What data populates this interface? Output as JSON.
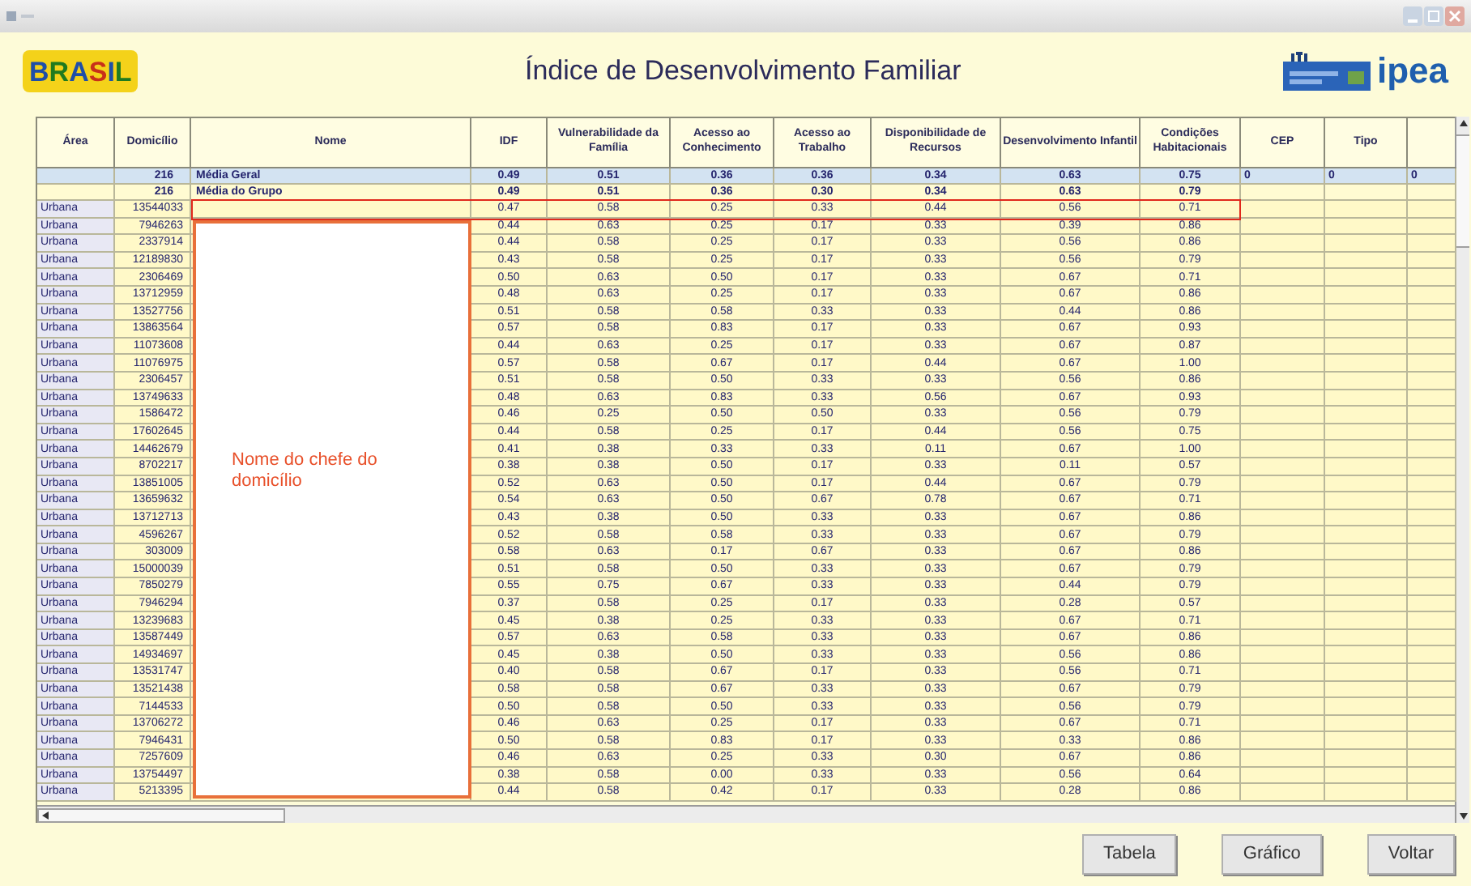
{
  "header": {
    "logo_left": "BRASIL",
    "title": "Índice de Desenvolvimento Familiar",
    "logo_right": "ipea"
  },
  "table": {
    "columns": [
      "Área",
      "Domicílio",
      "Nome",
      "IDF",
      "Vulnerabilidade da Família",
      "Acesso ao Conhecimento",
      "Acesso ao Trabalho",
      "Disponibilidade de Recursos",
      "Desenvolvimento Infantil",
      "Condições Habitacionais",
      "CEP",
      "Tipo"
    ],
    "summary_rows": [
      {
        "count": "216",
        "label": "Média Geral",
        "values": [
          "0.49",
          "0.51",
          "0.36",
          "0.36",
          "0.34",
          "0.63",
          "0.75"
        ],
        "extra": [
          "0",
          "0",
          "0"
        ],
        "selected": true
      },
      {
        "count": "216",
        "label": "Média do Grupo",
        "values": [
          "0.49",
          "0.51",
          "0.36",
          "0.30",
          "0.34",
          "0.63",
          "0.79"
        ],
        "selected": false
      }
    ],
    "rows": [
      {
        "area": "Urbana",
        "domicilio": "13544033",
        "values": [
          "0.47",
          "0.58",
          "0.25",
          "0.33",
          "0.44",
          "0.56",
          "0.71"
        ]
      },
      {
        "area": "Urbana",
        "domicilio": "7946263",
        "values": [
          "0.44",
          "0.63",
          "0.25",
          "0.17",
          "0.33",
          "0.39",
          "0.86"
        ]
      },
      {
        "area": "Urbana",
        "domicilio": "2337914",
        "values": [
          "0.44",
          "0.58",
          "0.25",
          "0.17",
          "0.33",
          "0.56",
          "0.86"
        ]
      },
      {
        "area": "Urbana",
        "domicilio": "12189830",
        "values": [
          "0.43",
          "0.58",
          "0.25",
          "0.17",
          "0.33",
          "0.56",
          "0.79"
        ]
      },
      {
        "area": "Urbana",
        "domicilio": "2306469",
        "values": [
          "0.50",
          "0.63",
          "0.50",
          "0.17",
          "0.33",
          "0.67",
          "0.71"
        ]
      },
      {
        "area": "Urbana",
        "domicilio": "13712959",
        "values": [
          "0.48",
          "0.63",
          "0.25",
          "0.17",
          "0.33",
          "0.67",
          "0.86"
        ]
      },
      {
        "area": "Urbana",
        "domicilio": "13527756",
        "values": [
          "0.51",
          "0.58",
          "0.58",
          "0.33",
          "0.33",
          "0.44",
          "0.86"
        ]
      },
      {
        "area": "Urbana",
        "domicilio": "13863564",
        "values": [
          "0.57",
          "0.58",
          "0.83",
          "0.17",
          "0.33",
          "0.67",
          "0.93"
        ]
      },
      {
        "area": "Urbana",
        "domicilio": "11073608",
        "values": [
          "0.44",
          "0.63",
          "0.25",
          "0.17",
          "0.33",
          "0.67",
          "0.87"
        ]
      },
      {
        "area": "Urbana",
        "domicilio": "11076975",
        "values": [
          "0.57",
          "0.58",
          "0.67",
          "0.17",
          "0.44",
          "0.67",
          "1.00"
        ]
      },
      {
        "area": "Urbana",
        "domicilio": "2306457",
        "values": [
          "0.51",
          "0.58",
          "0.50",
          "0.33",
          "0.33",
          "0.56",
          "0.86"
        ]
      },
      {
        "area": "Urbana",
        "domicilio": "13749633",
        "values": [
          "0.48",
          "0.63",
          "0.83",
          "0.33",
          "0.56",
          "0.67",
          "0.93"
        ]
      },
      {
        "area": "Urbana",
        "domicilio": "1586472",
        "values": [
          "0.46",
          "0.25",
          "0.50",
          "0.50",
          "0.33",
          "0.56",
          "0.79"
        ]
      },
      {
        "area": "Urbana",
        "domicilio": "17602645",
        "values": [
          "0.44",
          "0.58",
          "0.25",
          "0.17",
          "0.44",
          "0.56",
          "0.75"
        ]
      },
      {
        "area": "Urbana",
        "domicilio": "14462679",
        "values": [
          "0.41",
          "0.38",
          "0.33",
          "0.33",
          "0.11",
          "0.67",
          "1.00"
        ]
      },
      {
        "area": "Urbana",
        "domicilio": "8702217",
        "values": [
          "0.38",
          "0.38",
          "0.50",
          "0.17",
          "0.33",
          "0.11",
          "0.57"
        ]
      },
      {
        "area": "Urbana",
        "domicilio": "13851005",
        "values": [
          "0.52",
          "0.63",
          "0.50",
          "0.17",
          "0.44",
          "0.67",
          "0.79"
        ]
      },
      {
        "area": "Urbana",
        "domicilio": "13659632",
        "values": [
          "0.54",
          "0.63",
          "0.50",
          "0.67",
          "0.78",
          "0.67",
          "0.71"
        ]
      },
      {
        "area": "Urbana",
        "domicilio": "13712713",
        "values": [
          "0.43",
          "0.38",
          "0.50",
          "0.33",
          "0.33",
          "0.67",
          "0.86"
        ]
      },
      {
        "area": "Urbana",
        "domicilio": "4596267",
        "values": [
          "0.52",
          "0.58",
          "0.58",
          "0.33",
          "0.33",
          "0.67",
          "0.79"
        ]
      },
      {
        "area": "Urbana",
        "domicilio": "303009",
        "values": [
          "0.58",
          "0.63",
          "0.17",
          "0.67",
          "0.33",
          "0.67",
          "0.86"
        ]
      },
      {
        "area": "Urbana",
        "domicilio": "15000039",
        "values": [
          "0.51",
          "0.58",
          "0.50",
          "0.33",
          "0.33",
          "0.67",
          "0.79"
        ]
      },
      {
        "area": "Urbana",
        "domicilio": "7850279",
        "values": [
          "0.55",
          "0.75",
          "0.67",
          "0.33",
          "0.33",
          "0.44",
          "0.79"
        ]
      },
      {
        "area": "Urbana",
        "domicilio": "7946294",
        "values": [
          "0.37",
          "0.58",
          "0.25",
          "0.17",
          "0.33",
          "0.28",
          "0.57"
        ]
      },
      {
        "area": "Urbana",
        "domicilio": "13239683",
        "values": [
          "0.45",
          "0.38",
          "0.25",
          "0.33",
          "0.33",
          "0.67",
          "0.71"
        ]
      },
      {
        "area": "Urbana",
        "domicilio": "13587449",
        "values": [
          "0.57",
          "0.63",
          "0.58",
          "0.33",
          "0.33",
          "0.67",
          "0.86"
        ]
      },
      {
        "area": "Urbana",
        "domicilio": "14934697",
        "values": [
          "0.45",
          "0.38",
          "0.50",
          "0.33",
          "0.33",
          "0.56",
          "0.86"
        ]
      },
      {
        "area": "Urbana",
        "domicilio": "13531747",
        "values": [
          "0.40",
          "0.58",
          "0.67",
          "0.17",
          "0.33",
          "0.56",
          "0.71"
        ]
      },
      {
        "area": "Urbana",
        "domicilio": "13521438",
        "values": [
          "0.58",
          "0.58",
          "0.67",
          "0.33",
          "0.33",
          "0.67",
          "0.79"
        ]
      },
      {
        "area": "Urbana",
        "domicilio": "7144533",
        "values": [
          "0.50",
          "0.58",
          "0.50",
          "0.33",
          "0.33",
          "0.56",
          "0.79"
        ]
      },
      {
        "area": "Urbana",
        "domicilio": "13706272",
        "values": [
          "0.46",
          "0.63",
          "0.25",
          "0.17",
          "0.33",
          "0.67",
          "0.71"
        ]
      },
      {
        "area": "Urbana",
        "domicilio": "7946431",
        "values": [
          "0.50",
          "0.58",
          "0.83",
          "0.17",
          "0.33",
          "0.33",
          "0.86"
        ]
      },
      {
        "area": "Urbana",
        "domicilio": "7257609",
        "values": [
          "0.46",
          "0.63",
          "0.25",
          "0.33",
          "0.30",
          "0.67",
          "0.86"
        ]
      },
      {
        "area": "Urbana",
        "domicilio": "13754497",
        "values": [
          "0.38",
          "0.58",
          "0.00",
          "0.33",
          "0.33",
          "0.56",
          "0.64"
        ]
      },
      {
        "area": "Urbana",
        "domicilio": "5213395",
        "values": [
          "0.44",
          "0.58",
          "0.42",
          "0.17",
          "0.33",
          "0.28",
          "0.86"
        ]
      }
    ]
  },
  "annotation": {
    "callout": "Nome do chefe do domicílio"
  },
  "buttons": [
    "Tabela",
    "Gráfico",
    "Voltar"
  ]
}
